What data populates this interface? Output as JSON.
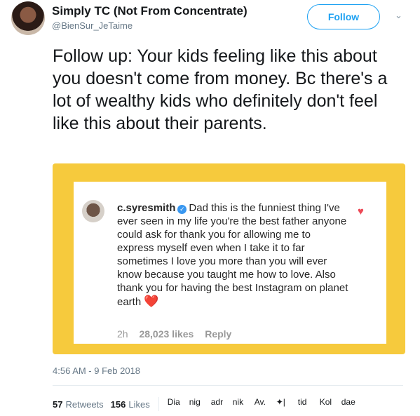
{
  "header": {
    "display_name": "Simply TC (Not From Concentrate)",
    "handle": "@BienSur_JeTaime",
    "follow_label": "Follow",
    "chevron": "⌄"
  },
  "tweet": {
    "text": "Follow up: Your kids feeling like this about you doesn't come from money. Bc there's a lot of wealthy kids who definitely don't feel like this about their parents."
  },
  "media": {
    "username": "c.syresmith",
    "verified_glyph": "✓",
    "comment": "Dad this is the funniest thing I've ever seen in my life you're the best father anyone could ask for thank you for allowing me to express myself even when I take it to far sometimes I love you more than you will ever know because you taught me how to love. Also thank you for having the best Instagram on planet earth",
    "heart_emoji": "❤️",
    "like_heart": "♥",
    "time": "2h",
    "likes": "28,023 likes",
    "reply_label": "Reply"
  },
  "timestamp": "4:56 AM - 9 Feb 2018",
  "stats": {
    "retweets_count": "57",
    "retweets_label": "Retweets",
    "likes_count": "156",
    "likes_label": "Likes"
  },
  "likers": [
    "Dia",
    "nig",
    "adr",
    "nik",
    "Av.",
    "✦|",
    "tid",
    "Kol",
    "dae"
  ],
  "colors": {
    "accent": "#1da1f2",
    "media_bg": "#f6ca3d",
    "heart": "#ed4956"
  },
  "icons": [
    "verified-icon",
    "heart-icon",
    "chevron-down-icon"
  ]
}
